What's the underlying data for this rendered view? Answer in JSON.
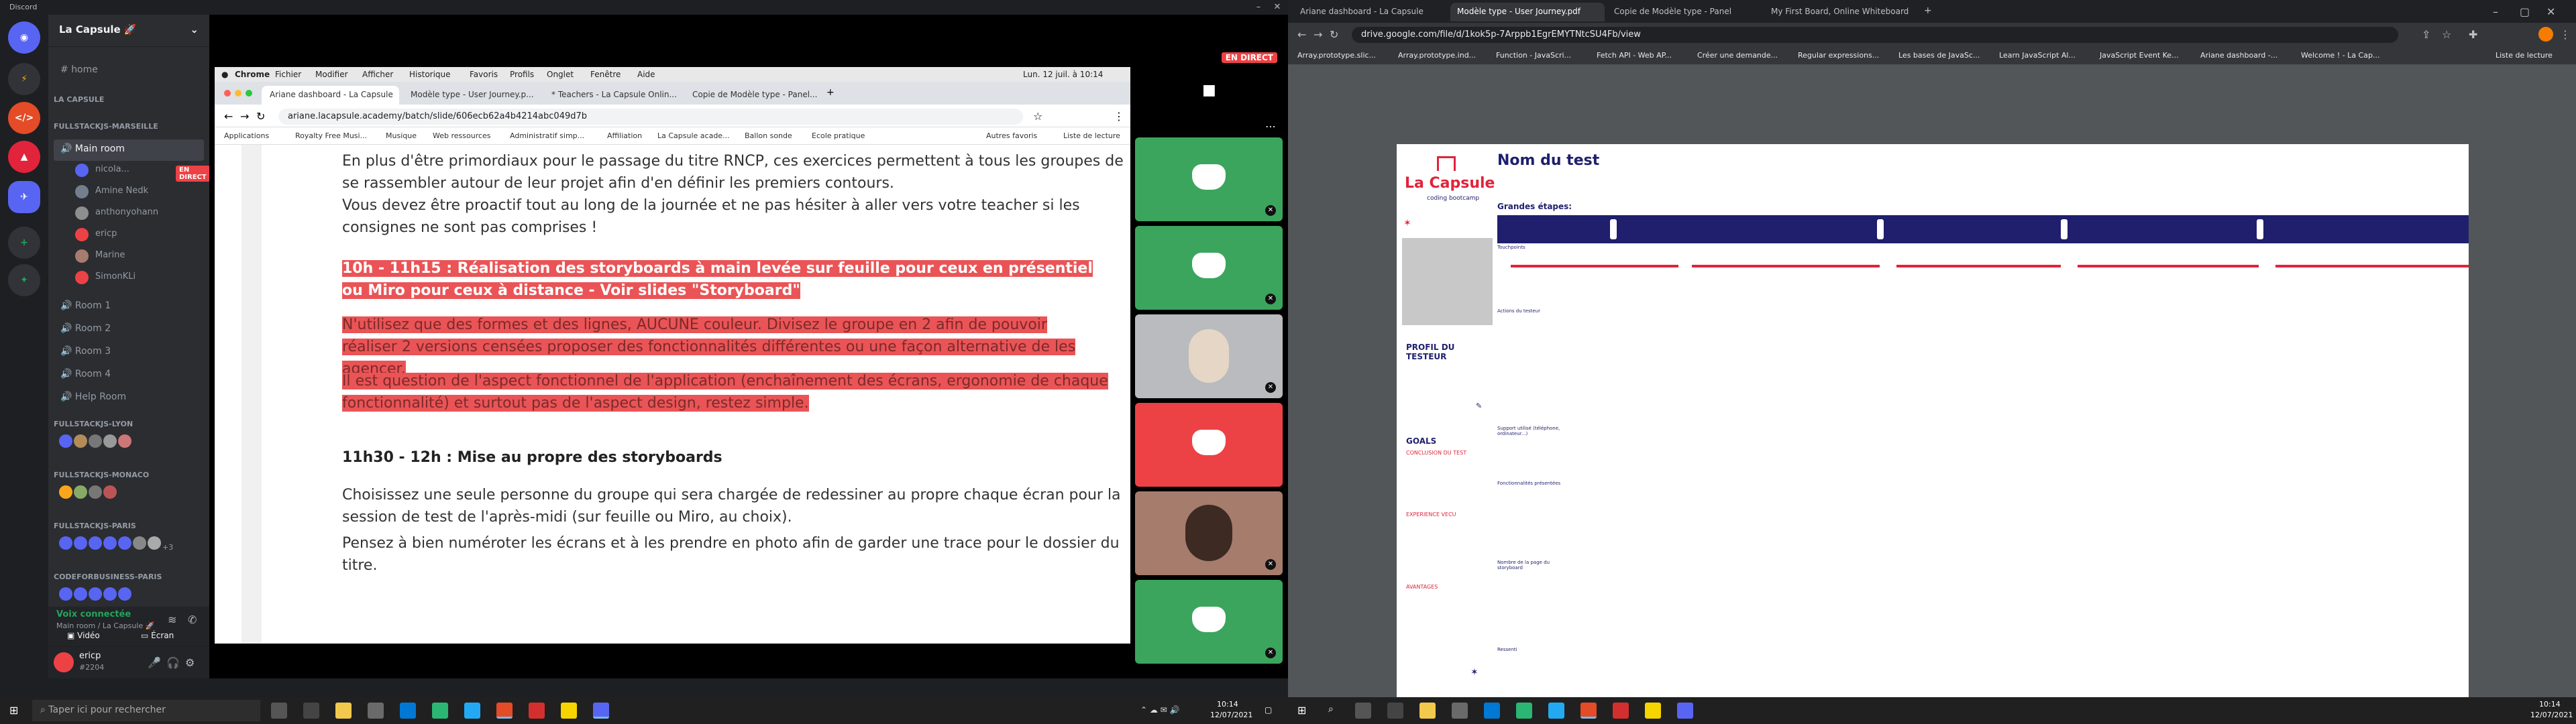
{
  "discord": {
    "window_title": "Discord",
    "server_name": "La Capsule 🚀",
    "home": "home",
    "categories": {
      "la_capsule": "LA CAPSULE",
      "marseille": "FULLSTACKJS-MARSEILLE",
      "lyon": "FULLSTACKJS-LYON",
      "monaco": "FULLSTACKJS-MONACO",
      "paris": "FULLSTACKJS-PARIS",
      "codeforbusiness": "CODEFORBUSINESS-PARIS"
    },
    "main_room": "Main room",
    "voice_users": [
      {
        "name": "nicola...",
        "live": "EN DIRECT"
      },
      {
        "name": "Amine Nedk"
      },
      {
        "name": "anthonyohann"
      },
      {
        "name": "ericp"
      },
      {
        "name": "Marine"
      },
      {
        "name": "SimonKLi"
      }
    ],
    "rooms": [
      "Room 1",
      "Room 2",
      "Room 3",
      "Room 4",
      "Help Room"
    ],
    "paris_extra": "+3",
    "voice_status": "Voix connectée",
    "voice_location": "Main room / La Capsule 🚀",
    "video_button": "Vidéo",
    "screen_button": "Écran",
    "username": "ericp",
    "user_tag": "#2204",
    "live_badge": "EN DIRECT"
  },
  "shared_screen": {
    "mac_menu": [
      "Chrome",
      "Fichier",
      "Modifier",
      "Afficher",
      "Historique",
      "Favoris",
      "Profils",
      "Onglet",
      "Fenêtre",
      "Aide"
    ],
    "mac_clock": "Lun. 12 juil. à 10:14",
    "tabs": [
      "Ariane dashboard - La Capsule",
      "Modèle type - User Journey.p...",
      "* Teachers - La Capsule Onlin...",
      "Copie de Modèle type - Panel..."
    ],
    "url": "ariane.lacapsule.academy/batch/slide/606ecb62a4b4214abc049d7b",
    "bookmarks": [
      "Applications",
      "Royalty Free Musi...",
      "Musique",
      "Web ressources",
      "Administratif simp...",
      "Affiliation",
      "La Capsule acade...",
      "Ballon sonde",
      "Ecole pratique",
      "Autres favoris",
      "Liste de lecture"
    ],
    "para1": "En plus d'être primordiaux pour le passage du titre RNCP, ces exercices permettent à tous les groupes de se rassembler autour de leur projet afin d'en définir les premiers contours.",
    "para2": "Vous devez être proactif tout au long de la journée et ne pas hésiter à aller vers votre teacher si les consignes ne sont pas comprises !",
    "heading1": "10h - 11h15 : Réalisation des storyboards à main levée sur feuille pour ceux en présentiel ou Miro pour ceux à distance - Voir slides \"Storyboard\"",
    "hl2": "N'utilisez que des formes et des lignes, AUCUNE couleur. Divisez le groupe en 2 afin de pouvoir réaliser 2 versions censées proposer des fonctionnalités différentes ou une façon alternative de les agencer.",
    "hl3": "Il est question de l'aspect fonctionnel de l'application (enchaînement des écrans, ergonomie de chaque fonctionnalité) et surtout pas de l'aspect design, restez simple.",
    "heading2": "11h30 - 12h : Mise au propre des storyboards",
    "para3": "Choisissez une seule personne du groupe qui sera chargée de redessiner au propre chaque écran pour la session de test de l'après-midi (sur feuille ou Miro, au choix).",
    "para4": "Pensez à bien numéroter les écrans et à les prendre en photo afin de garder une trace pour le dossier du titre."
  },
  "left_taskbar": {
    "search_placeholder": "Taper ici pour rechercher",
    "time": "10:14",
    "date": "12/07/2021"
  },
  "right_browser": {
    "tabs": [
      "Ariane dashboard - La Capsule",
      "Modèle type - User Journey.pdf",
      "Copie de Modèle type - Panel",
      "My First Board, Online Whiteboard"
    ],
    "url": "drive.google.com/file/d/1kok5p-7Arppb1EgrEMYTNtcSU4Fb/view",
    "bookmarks": [
      "Array.prototype.slic...",
      "Array.prototype.ind...",
      "Function - JavaScri...",
      "Fetch API - Web AP...",
      "Créer une demande...",
      "Regular expressions...",
      "Les bases de JavaSc...",
      "Learn JavaScript Al...",
      "JavaScript Event Ke...",
      "Ariane dashboard -...",
      "Welcome ! - La Cap...",
      "Liste de lecture"
    ]
  },
  "pdf": {
    "title": "Nom du test",
    "logo": "La Capsule",
    "logo_sub": "coding bootcamp",
    "grandes_etapes": "Grandes étapes:",
    "touchpoints": "Touchpoints",
    "actions": "Actions du testeur",
    "profil": "PROFIL DU TESTEUR",
    "goals": "GOALS",
    "goal1": "CONCLUSION DU TEST",
    "goal2": "EXPERIENCE VECU",
    "goal3": "AVANTAGES",
    "support": "Support utilisé (téléphone, ordinateur...)",
    "fonctionnalites": "Fonctionnalités présentées",
    "nombre_pages": "Nombre de la page du storyboard",
    "ressenti": "Ressenti"
  },
  "right_taskbar": {
    "time": "10:14",
    "date": "12/07/2021"
  },
  "colors": {
    "discord_accent": "#5865f2",
    "tile_green": "#3ba55d",
    "tile_red": "#ed4245",
    "highlight": "#ea5456",
    "pdf_navy": "#1f1f6e",
    "pdf_red": "#e1233b"
  }
}
